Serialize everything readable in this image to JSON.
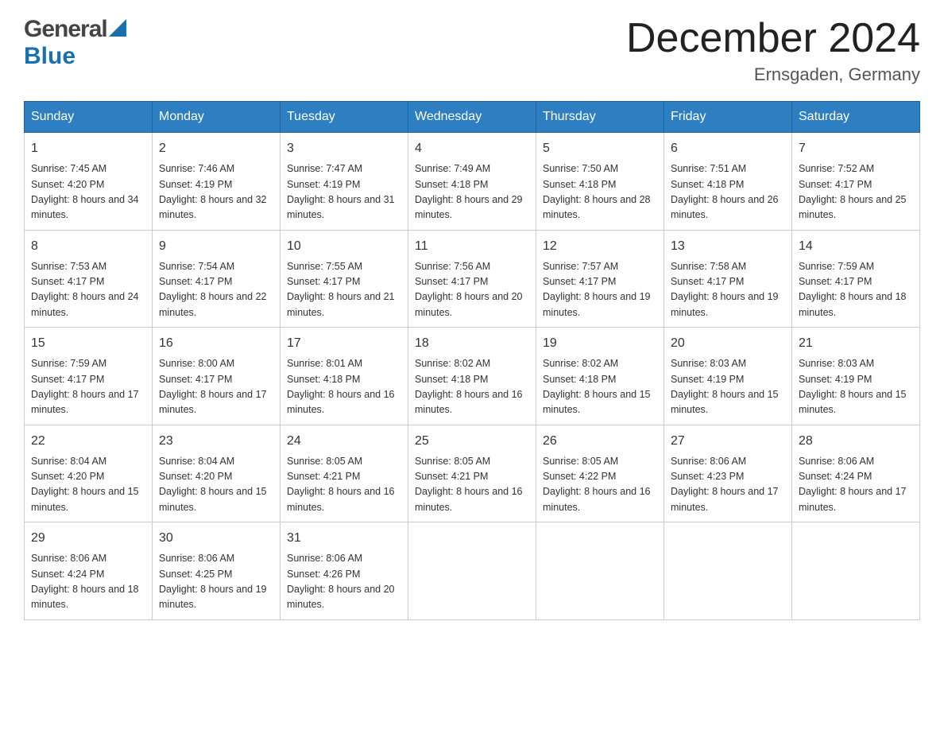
{
  "header": {
    "logo_general": "General",
    "logo_blue": "Blue",
    "month_title": "December 2024",
    "location": "Ernsgaden, Germany"
  },
  "weekdays": [
    "Sunday",
    "Monday",
    "Tuesday",
    "Wednesday",
    "Thursday",
    "Friday",
    "Saturday"
  ],
  "weeks": [
    [
      {
        "day": "1",
        "sunrise": "7:45 AM",
        "sunset": "4:20 PM",
        "daylight": "8 hours and 34 minutes."
      },
      {
        "day": "2",
        "sunrise": "7:46 AM",
        "sunset": "4:19 PM",
        "daylight": "8 hours and 32 minutes."
      },
      {
        "day": "3",
        "sunrise": "7:47 AM",
        "sunset": "4:19 PM",
        "daylight": "8 hours and 31 minutes."
      },
      {
        "day": "4",
        "sunrise": "7:49 AM",
        "sunset": "4:18 PM",
        "daylight": "8 hours and 29 minutes."
      },
      {
        "day": "5",
        "sunrise": "7:50 AM",
        "sunset": "4:18 PM",
        "daylight": "8 hours and 28 minutes."
      },
      {
        "day": "6",
        "sunrise": "7:51 AM",
        "sunset": "4:18 PM",
        "daylight": "8 hours and 26 minutes."
      },
      {
        "day": "7",
        "sunrise": "7:52 AM",
        "sunset": "4:17 PM",
        "daylight": "8 hours and 25 minutes."
      }
    ],
    [
      {
        "day": "8",
        "sunrise": "7:53 AM",
        "sunset": "4:17 PM",
        "daylight": "8 hours and 24 minutes."
      },
      {
        "day": "9",
        "sunrise": "7:54 AM",
        "sunset": "4:17 PM",
        "daylight": "8 hours and 22 minutes."
      },
      {
        "day": "10",
        "sunrise": "7:55 AM",
        "sunset": "4:17 PM",
        "daylight": "8 hours and 21 minutes."
      },
      {
        "day": "11",
        "sunrise": "7:56 AM",
        "sunset": "4:17 PM",
        "daylight": "8 hours and 20 minutes."
      },
      {
        "day": "12",
        "sunrise": "7:57 AM",
        "sunset": "4:17 PM",
        "daylight": "8 hours and 19 minutes."
      },
      {
        "day": "13",
        "sunrise": "7:58 AM",
        "sunset": "4:17 PM",
        "daylight": "8 hours and 19 minutes."
      },
      {
        "day": "14",
        "sunrise": "7:59 AM",
        "sunset": "4:17 PM",
        "daylight": "8 hours and 18 minutes."
      }
    ],
    [
      {
        "day": "15",
        "sunrise": "7:59 AM",
        "sunset": "4:17 PM",
        "daylight": "8 hours and 17 minutes."
      },
      {
        "day": "16",
        "sunrise": "8:00 AM",
        "sunset": "4:17 PM",
        "daylight": "8 hours and 17 minutes."
      },
      {
        "day": "17",
        "sunrise": "8:01 AM",
        "sunset": "4:18 PM",
        "daylight": "8 hours and 16 minutes."
      },
      {
        "day": "18",
        "sunrise": "8:02 AM",
        "sunset": "4:18 PM",
        "daylight": "8 hours and 16 minutes."
      },
      {
        "day": "19",
        "sunrise": "8:02 AM",
        "sunset": "4:18 PM",
        "daylight": "8 hours and 15 minutes."
      },
      {
        "day": "20",
        "sunrise": "8:03 AM",
        "sunset": "4:19 PM",
        "daylight": "8 hours and 15 minutes."
      },
      {
        "day": "21",
        "sunrise": "8:03 AM",
        "sunset": "4:19 PM",
        "daylight": "8 hours and 15 minutes."
      }
    ],
    [
      {
        "day": "22",
        "sunrise": "8:04 AM",
        "sunset": "4:20 PM",
        "daylight": "8 hours and 15 minutes."
      },
      {
        "day": "23",
        "sunrise": "8:04 AM",
        "sunset": "4:20 PM",
        "daylight": "8 hours and 15 minutes."
      },
      {
        "day": "24",
        "sunrise": "8:05 AM",
        "sunset": "4:21 PM",
        "daylight": "8 hours and 16 minutes."
      },
      {
        "day": "25",
        "sunrise": "8:05 AM",
        "sunset": "4:21 PM",
        "daylight": "8 hours and 16 minutes."
      },
      {
        "day": "26",
        "sunrise": "8:05 AM",
        "sunset": "4:22 PM",
        "daylight": "8 hours and 16 minutes."
      },
      {
        "day": "27",
        "sunrise": "8:06 AM",
        "sunset": "4:23 PM",
        "daylight": "8 hours and 17 minutes."
      },
      {
        "day": "28",
        "sunrise": "8:06 AM",
        "sunset": "4:24 PM",
        "daylight": "8 hours and 17 minutes."
      }
    ],
    [
      {
        "day": "29",
        "sunrise": "8:06 AM",
        "sunset": "4:24 PM",
        "daylight": "8 hours and 18 minutes."
      },
      {
        "day": "30",
        "sunrise": "8:06 AM",
        "sunset": "4:25 PM",
        "daylight": "8 hours and 19 minutes."
      },
      {
        "day": "31",
        "sunrise": "8:06 AM",
        "sunset": "4:26 PM",
        "daylight": "8 hours and 20 minutes."
      },
      null,
      null,
      null,
      null
    ]
  ]
}
